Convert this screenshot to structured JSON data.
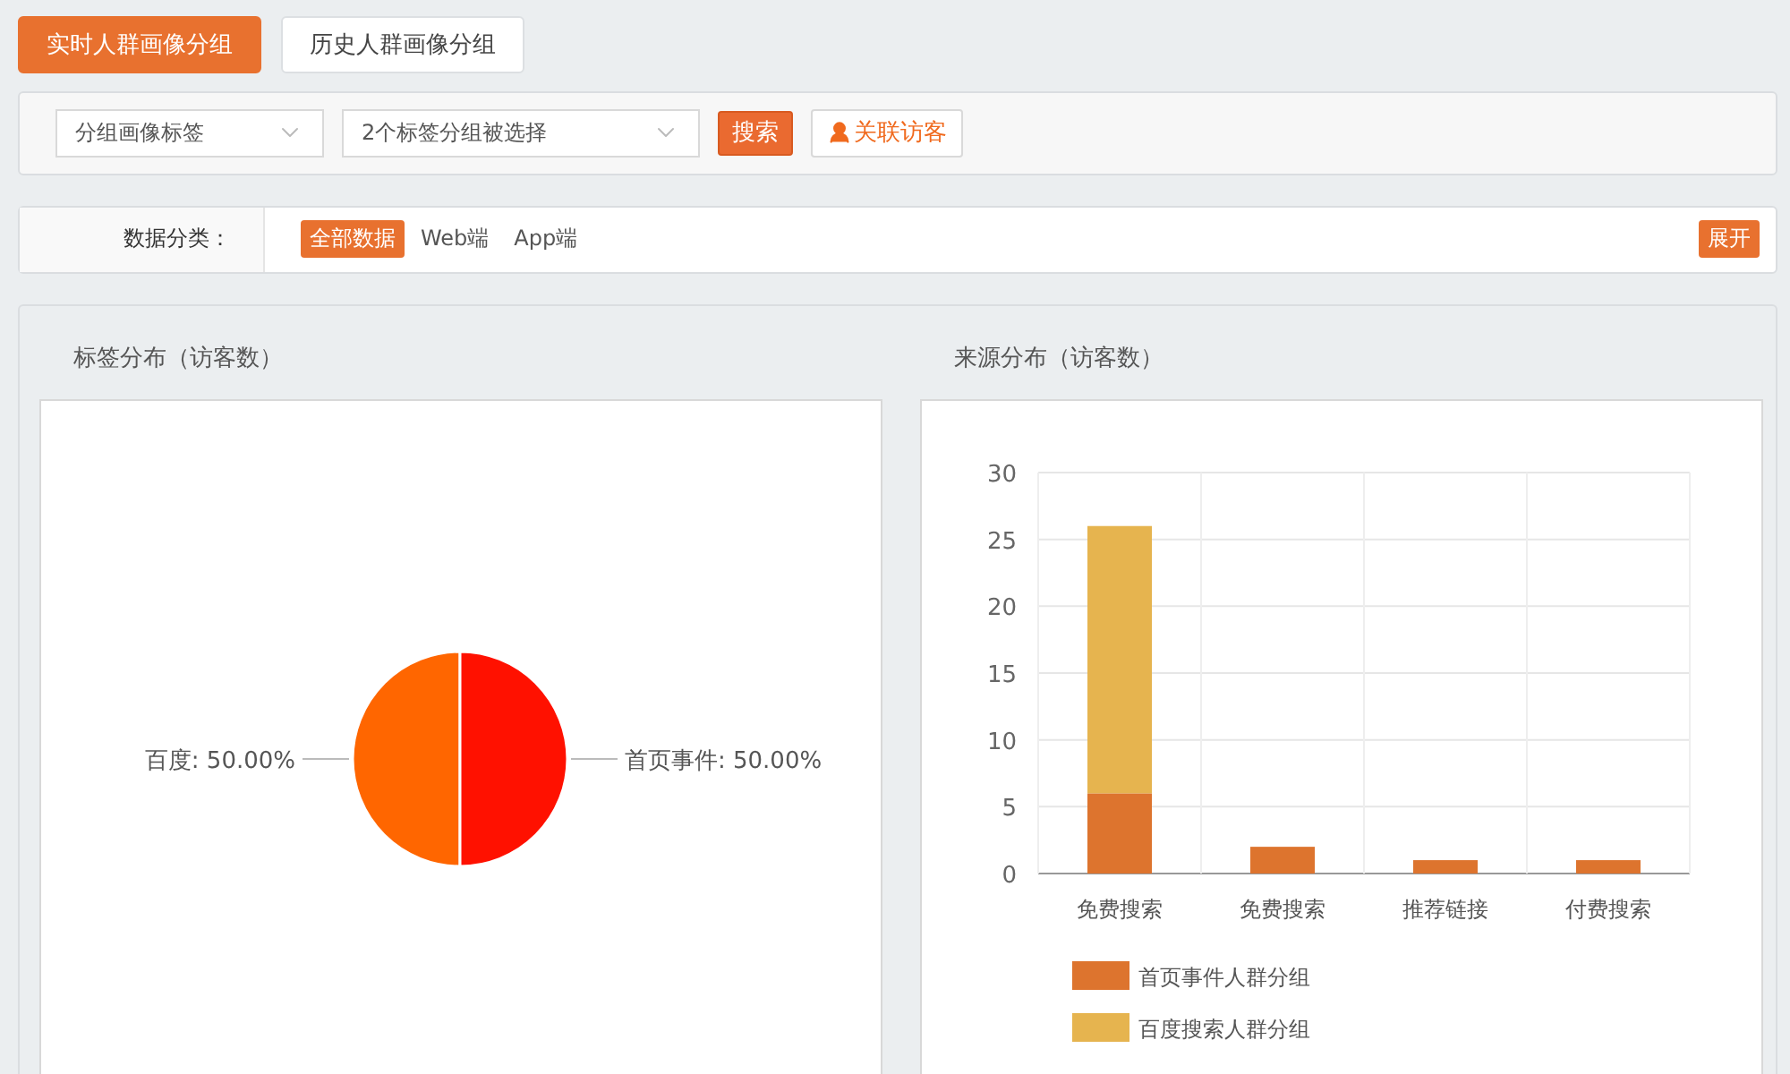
{
  "tabs": [
    {
      "label": "实时人群画像分组",
      "selected": true
    },
    {
      "label": "历史人群画像分组",
      "selected": false
    }
  ],
  "filters": {
    "selects": [
      {
        "value": "分组画像标签"
      },
      {
        "value": "2个标签分组被选择"
      }
    ],
    "search_button": "搜索",
    "link_visitor_button": "关联访客"
  },
  "category": {
    "label": "数据分类：",
    "options": [
      {
        "label": "全部数据",
        "selected": true
      },
      {
        "label": "Web端",
        "selected": false
      },
      {
        "label": "App端",
        "selected": false
      }
    ],
    "expand_button": "展开"
  },
  "panels": [
    {
      "title": "标签分布（访客数）",
      "chart_data": {
        "type": "pie",
        "values": [
          50,
          50
        ],
        "value_labels": [
          "百度: 50.00%",
          "首页事件: 50.00%"
        ]
      }
    },
    {
      "title": "来源分布（访客数）",
      "chart_data": {
        "type": "bar",
        "stacked": true,
        "grid": true,
        "legend": true,
        "categories": [
          "免费搜索",
          "免费搜索",
          "推荐链接",
          "付费搜索"
        ],
        "ylim": [
          0,
          30
        ],
        "yticks": [
          0,
          5,
          10,
          15,
          20,
          25,
          30
        ],
        "series": [
          {
            "name": "首页事件人群分组",
            "color": "#dd742e",
            "values": [
              6,
              2,
              1,
              1
            ]
          },
          {
            "name": "百度搜索人群分组",
            "color": "#e6b44f",
            "values": [
              20,
              0,
              0,
              0
            ]
          }
        ]
      }
    }
  ]
}
